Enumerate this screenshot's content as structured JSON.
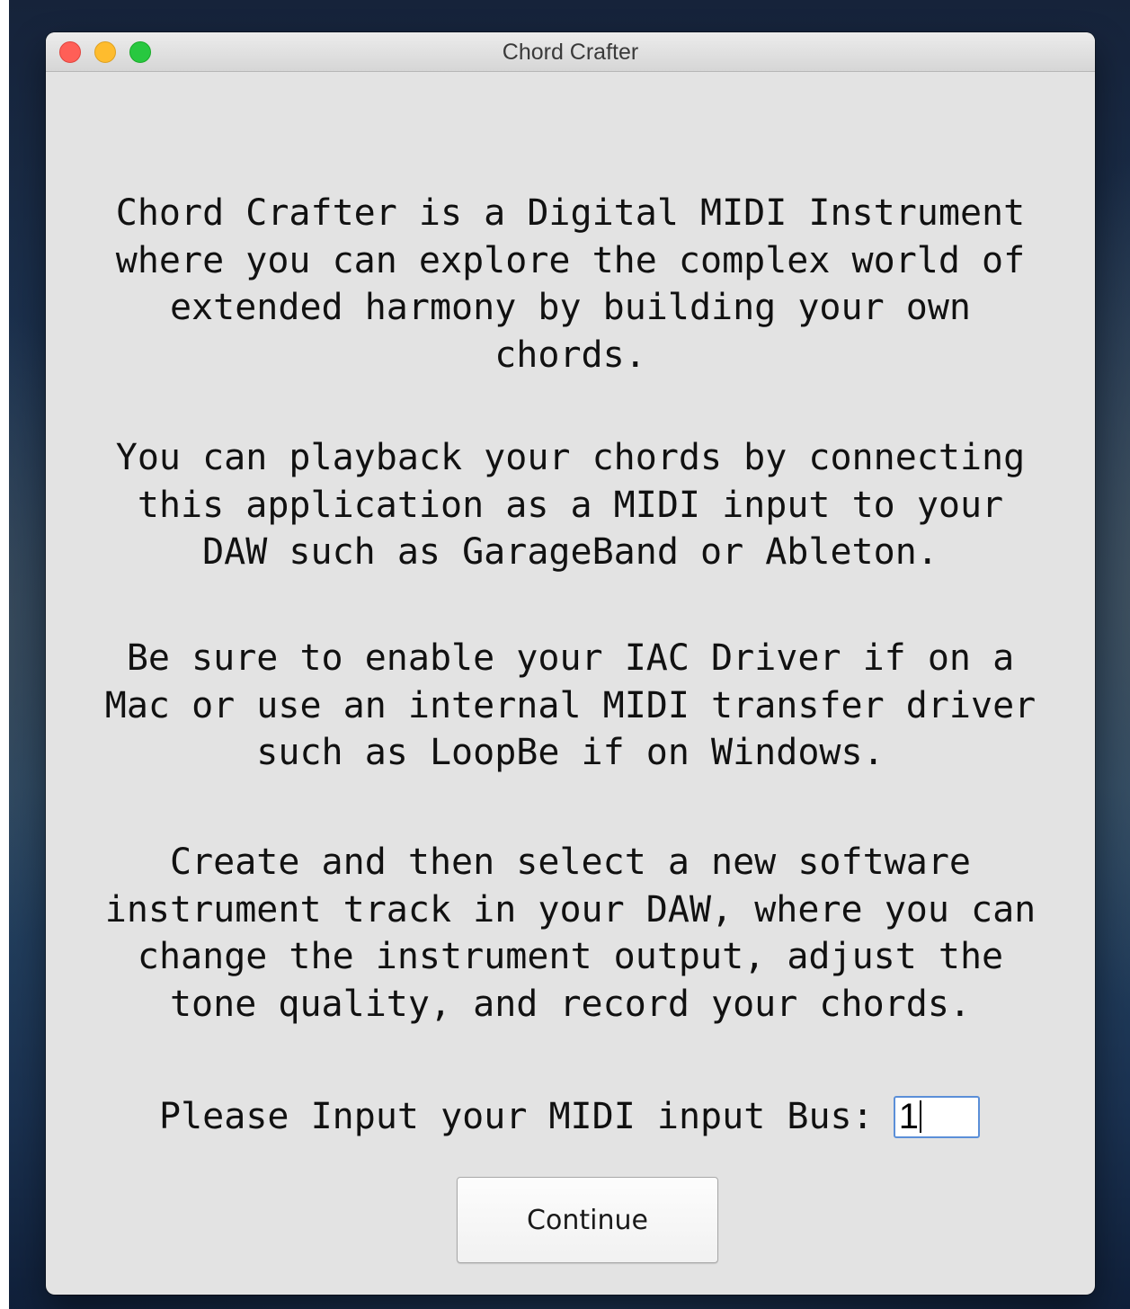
{
  "window": {
    "title": "Chord Crafter"
  },
  "intro": {
    "paragraph1": [
      "Chord Crafter is a Digital MIDI Instrument",
      "where you can explore the complex world of",
      "extended harmony by building your own",
      "chords."
    ],
    "paragraph2": [
      "You can playback your chords by connecting",
      "this application as a MIDI input to your",
      "DAW such as GarageBand or Ableton."
    ],
    "paragraph3": [
      "Be sure to enable your IAC Driver if on a",
      "Mac or use an internal MIDI transfer driver",
      "such as LoopBe if on Windows."
    ],
    "paragraph4": [
      "Create and then select a new software",
      "instrument track in your DAW, where you can",
      "change the instrument output, adjust the",
      "tone quality, and record your chords."
    ]
  },
  "bus": {
    "label": "Please Input your MIDI input Bus:",
    "value": "1"
  },
  "continue_label": "Continue",
  "colors": {
    "close": "#ff5f57",
    "minimize": "#febc2e",
    "maximize": "#28c840",
    "window_bg": "#e3e3e3",
    "focus_ring": "#5b8fd8"
  }
}
